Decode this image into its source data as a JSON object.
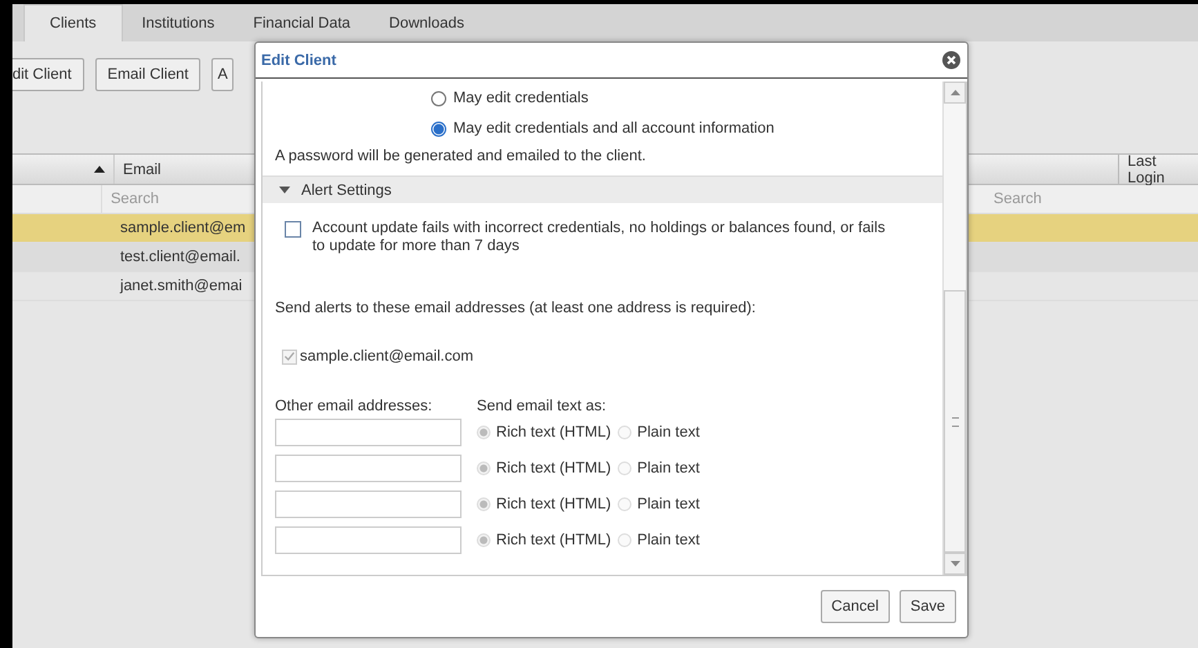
{
  "tabs": [
    {
      "label": "Clients",
      "selected": true
    },
    {
      "label": "Institutions",
      "selected": false
    },
    {
      "label": "Financial Data",
      "selected": false
    },
    {
      "label": "Downloads",
      "selected": false
    }
  ],
  "toolbar": {
    "buttons": [
      "dit Client",
      "Email Client",
      "A"
    ]
  },
  "table": {
    "columns": [
      {
        "sorted": true
      },
      {
        "label": "Email",
        "sorted": false
      },
      {
        "label": "Last Login",
        "sorted": false
      }
    ],
    "search_placeholders": [
      "Search",
      "Search"
    ],
    "rows": [
      {
        "email": "sample.client@em",
        "selected": true
      },
      {
        "email": "test.client@email.",
        "selected": false
      },
      {
        "email": "janet.smith@emai",
        "selected": false
      }
    ]
  },
  "dialog": {
    "title": "Edit Client",
    "access_options": [
      {
        "label": "May edit credentials",
        "selected": false
      },
      {
        "label": "May edit credentials and all account information",
        "selected": true
      }
    ],
    "password_note": "A password will be generated and emailed to the client.",
    "alert_section": {
      "title": "Alert Settings",
      "expanded": true,
      "alerts": [
        {
          "label": "Account update fails with incorrect credentials, no holdings or balances found, or fails to update for more than 7 days",
          "checked": false
        }
      ],
      "recipients_label": "Send alerts to these email addresses (at least one address is required):",
      "recipients": [
        {
          "email": "sample.client@email.com",
          "checked": true,
          "disabled": true
        }
      ],
      "other_label": "Other email addresses:",
      "format_label": "Send email text as:",
      "other_rows": [
        {
          "options": [
            {
              "label": "Rich text (HTML)",
              "selected": true
            },
            {
              "label": "Plain text",
              "selected": false
            }
          ]
        },
        {
          "options": [
            {
              "label": "Rich text (HTML)",
              "selected": true
            },
            {
              "label": "Plain text",
              "selected": false
            }
          ]
        },
        {
          "options": [
            {
              "label": "Rich text (HTML)",
              "selected": true
            },
            {
              "label": "Plain text",
              "selected": false
            }
          ]
        },
        {
          "options": [
            {
              "label": "Rich text (HTML)",
              "selected": true
            },
            {
              "label": "Plain text",
              "selected": false
            }
          ]
        }
      ]
    },
    "buttons": [
      "Cancel",
      "Save"
    ]
  }
}
